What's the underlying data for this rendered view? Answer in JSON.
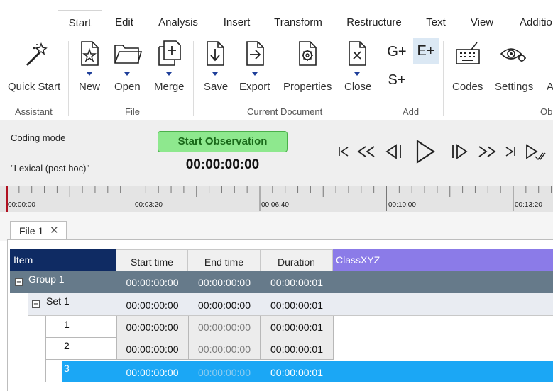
{
  "tabs": [
    "Start",
    "Edit",
    "Analysis",
    "Insert",
    "Transform",
    "Restructure",
    "Text",
    "View",
    "Additio"
  ],
  "active_tab": "Start",
  "ribbon": {
    "quick_start": "Quick Start",
    "new": "New",
    "open": "Open",
    "merge": "Merge",
    "save": "Save",
    "export": "Export",
    "properties": "Properties",
    "close": "Close",
    "add_group": "G+",
    "add_event": "E+",
    "add_set": "S+",
    "codes": "Codes",
    "settings": "Settings",
    "partial_a": "A",
    "groups": {
      "assistant": "Assistant",
      "file": "File",
      "current_document": "Current Document",
      "add": "Add",
      "partial_ob": "Ob"
    }
  },
  "coding": {
    "mode_label": "Coding mode",
    "mode_value": "\"Lexical (post hoc)\"",
    "start_button": "Start Observation",
    "timer": "00:00:00:00"
  },
  "timeline": {
    "labels": [
      "00:00:00",
      "00:03:20",
      "00:06:40",
      "00:10:00",
      "00:13:20"
    ]
  },
  "file_tab": {
    "label": "File 1"
  },
  "grid": {
    "headers": {
      "item": "Item",
      "start": "Start time",
      "end": "End time",
      "duration": "Duration",
      "class": "ClassXYZ"
    },
    "rows": [
      {
        "label": "Group  1",
        "start": "00:00:00:00",
        "end": "00:00:00:00",
        "duration": "00:00:00:01"
      },
      {
        "label": "Set  1",
        "start": "00:00:00:00",
        "end": "00:00:00:00",
        "duration": "00:00:00:01"
      },
      {
        "label": "1",
        "start": "00:00:00:00",
        "end": "00:00:00:00",
        "duration": "00:00:00:01"
      },
      {
        "label": "2",
        "start": "00:00:00:00",
        "end": "00:00:00:00",
        "duration": "00:00:00:01"
      },
      {
        "label": "3",
        "start": "00:00:00:00",
        "end": "00:00:00:00",
        "duration": "00:00:00:01"
      }
    ]
  },
  "colors": {
    "item_header": "#0f2b63",
    "class_header": "#8b7be8",
    "group_row": "#667a8a",
    "set_row": "#e9ecf2",
    "selected_row": "#1ba7f5",
    "start_button": "#8ee88e",
    "add_event_highlight": "#dbe8f4"
  }
}
